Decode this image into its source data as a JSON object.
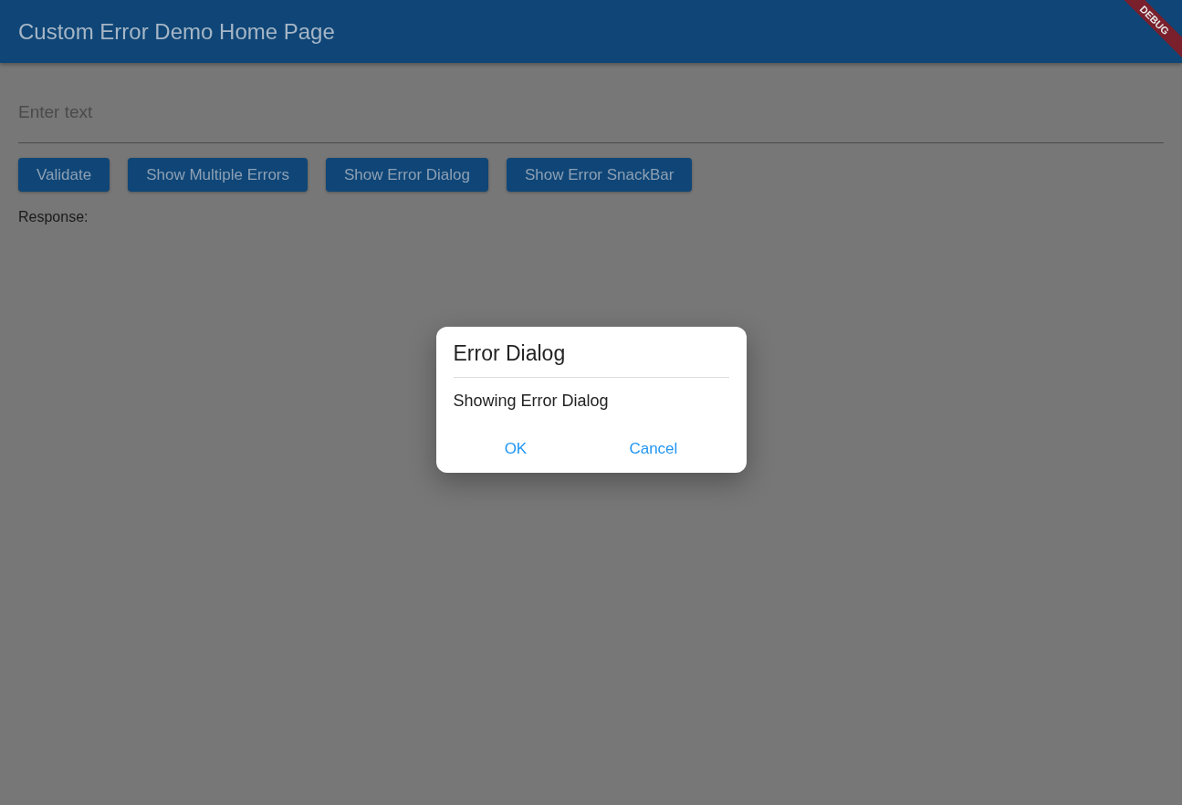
{
  "app_bar": {
    "title": "Custom Error Demo Home Page",
    "debug_banner": "DEBUG"
  },
  "text_field": {
    "placeholder": "Enter text"
  },
  "buttons": [
    "Validate",
    "Show Multiple Errors",
    "Show Error Dialog",
    "Show Error SnackBar"
  ],
  "response_label": "Response:",
  "dialog": {
    "title": "Error Dialog",
    "message": "Showing Error Dialog",
    "actions": [
      "OK",
      "Cancel"
    ]
  }
}
